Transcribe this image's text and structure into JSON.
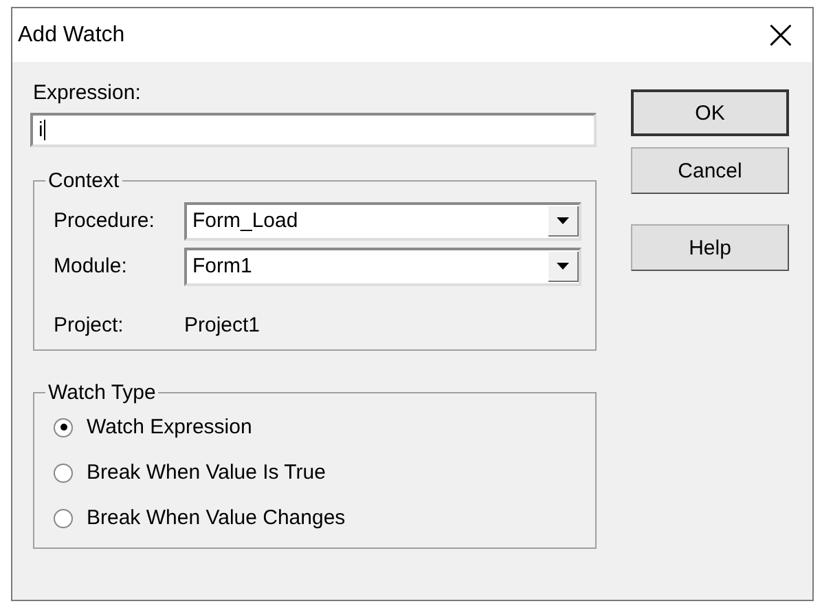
{
  "window": {
    "title": "Add Watch",
    "close": "×"
  },
  "expression": {
    "label": "Expression:",
    "value": "i"
  },
  "context": {
    "title": "Context",
    "procedure": {
      "label": "Procedure:",
      "value": "Form_Load"
    },
    "module": {
      "label": "Module:",
      "value": "Form1"
    },
    "project": {
      "label": "Project:",
      "value": "Project1"
    }
  },
  "watch_type": {
    "title": "Watch Type",
    "options": [
      {
        "label": "Watch Expression",
        "selected": true
      },
      {
        "label": "Break When Value Is True",
        "selected": false
      },
      {
        "label": "Break When Value Changes",
        "selected": false
      }
    ]
  },
  "buttons": [
    {
      "label": "OK",
      "default": true
    },
    {
      "label": "Cancel",
      "default": false
    },
    {
      "label": "Help",
      "default": false
    }
  ]
}
